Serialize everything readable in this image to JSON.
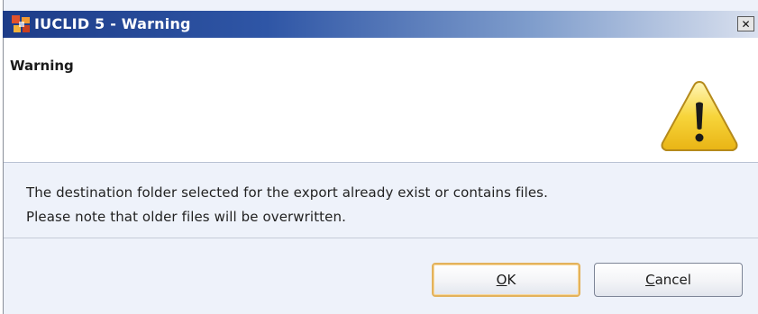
{
  "window": {
    "title": "IUCLID 5 - Warning",
    "close_glyph": "✕"
  },
  "header": {
    "title": "Warning",
    "icon": "warning-icon"
  },
  "message": {
    "line1": "The destination folder selected for the export already exist or contains files.",
    "line2": "Please note that older files will be overwritten."
  },
  "buttons": {
    "ok": {
      "prefix": "",
      "mnemonic": "O",
      "rest": "K"
    },
    "cancel": {
      "prefix": "",
      "mnemonic": "C",
      "rest": "ancel"
    }
  },
  "colors": {
    "titlebar_start": "#1d3c88",
    "titlebar_end": "#d9e0ee",
    "default_button_border": "#e3b25c",
    "warning_fill": "#f7d53b",
    "panel_bg": "#eef2fa"
  }
}
